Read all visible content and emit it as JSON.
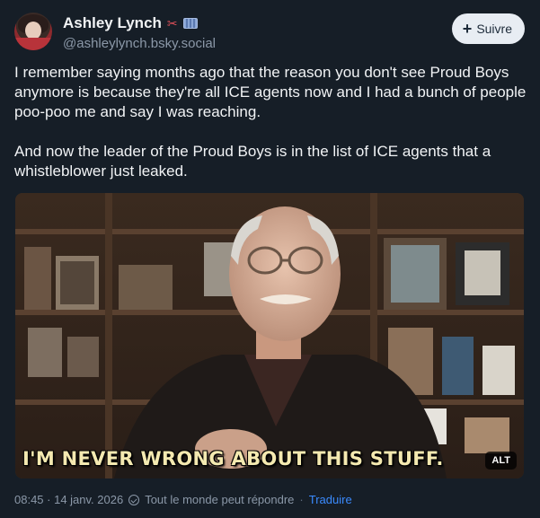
{
  "author": {
    "display_name": "Ashley Lynch",
    "handle": "@ashleylynch.bsky.social",
    "name_emojis": [
      "✂️",
      "🎞️"
    ]
  },
  "follow_button": {
    "label": "Suivre",
    "icon": "plus-icon"
  },
  "post": {
    "text": "I remember saying months ago that the reason you don't see Proud Boys anymore is because they're all ICE agents now and I had a bunch of people poo-poo me and say I was reaching.\n\nAnd now the leader of the Proud Boys is in the list of ICE agents that a whistleblower just leaked."
  },
  "media": {
    "caption": "I'M NEVER WRONG ABOUT THIS STUFF.",
    "alt_badge": "ALT"
  },
  "meta": {
    "timestamp": "08:45 · 14 janv. 2026",
    "reply_setting": "Tout le monde peut répondre",
    "separator": "·",
    "translate": "Traduire"
  },
  "colors": {
    "background": "#161e27",
    "text": "#f1f3f5",
    "muted": "#8b98a8",
    "link": "#3b8bff",
    "button_bg": "#e8edf3"
  }
}
